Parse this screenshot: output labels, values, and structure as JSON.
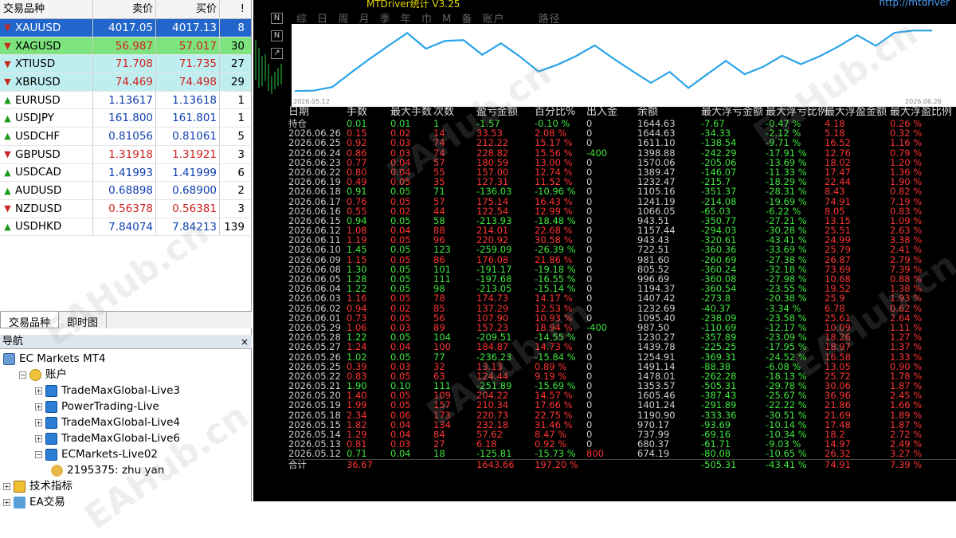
{
  "market_watch": {
    "headers": {
      "symbol": "交易品种",
      "bid": "卖价",
      "ask": "买价",
      "spread": "!"
    },
    "rows": [
      {
        "symbol": "XAUUSD",
        "bid": "4017.05",
        "ask": "4017.13",
        "spread": "8",
        "dir": "dn",
        "style": "hl-blue"
      },
      {
        "symbol": "XAGUSD",
        "bid": "56.987",
        "ask": "57.017",
        "spread": "30",
        "dir": "dn",
        "style": "hl-green"
      },
      {
        "symbol": "XTIUSD",
        "bid": "71.708",
        "ask": "71.735",
        "spread": "27",
        "dir": "dn",
        "style": "hl-cyan"
      },
      {
        "symbol": "XBRUSD",
        "bid": "74.469",
        "ask": "74.498",
        "spread": "29",
        "dir": "dn",
        "style": "hl-cyan"
      },
      {
        "symbol": "EURUSD",
        "bid": "1.13617",
        "ask": "1.13618",
        "spread": "1",
        "dir": "up",
        "style": ""
      },
      {
        "symbol": "USDJPY",
        "bid": "161.800",
        "ask": "161.801",
        "spread": "1",
        "dir": "up",
        "style": ""
      },
      {
        "symbol": "USDCHF",
        "bid": "0.81056",
        "ask": "0.81061",
        "spread": "5",
        "dir": "up",
        "style": ""
      },
      {
        "symbol": "GBPUSD",
        "bid": "1.31918",
        "ask": "1.31921",
        "spread": "3",
        "dir": "dn",
        "style": ""
      },
      {
        "symbol": "USDCAD",
        "bid": "1.41993",
        "ask": "1.41999",
        "spread": "6",
        "dir": "up",
        "style": ""
      },
      {
        "symbol": "AUDUSD",
        "bid": "0.68898",
        "ask": "0.68900",
        "spread": "2",
        "dir": "up",
        "style": ""
      },
      {
        "symbol": "NZDUSD",
        "bid": "0.56378",
        "ask": "0.56381",
        "spread": "3",
        "dir": "dn",
        "style": ""
      },
      {
        "symbol": "USDHKD",
        "bid": "7.84074",
        "ask": "7.84213",
        "spread": "139",
        "dir": "up",
        "style": ""
      }
    ],
    "tabs": [
      "交易品种",
      "即时图"
    ]
  },
  "navigator": {
    "title": "导航",
    "close": "×",
    "items": [
      {
        "label": "EC Markets MT4",
        "level": 0,
        "pm": "",
        "icon": "ic-server"
      },
      {
        "label": "账户",
        "level": 1,
        "pm": "-",
        "icon": "ic-folder"
      },
      {
        "label": "TradeMaxGlobal-Live3",
        "level": 2,
        "pm": "+",
        "icon": "ic-acct"
      },
      {
        "label": "PowerTrading-Live",
        "level": 2,
        "pm": "+",
        "icon": "ic-acct"
      },
      {
        "label": "TradeMaxGlobal-Live4",
        "level": 2,
        "pm": "+",
        "icon": "ic-acct"
      },
      {
        "label": "TradeMaxGlobal-Live6",
        "level": 2,
        "pm": "+",
        "icon": "ic-acct"
      },
      {
        "label": "ECMarkets-Live02",
        "level": 2,
        "pm": "-",
        "icon": "ic-acct"
      },
      {
        "label": "2195375: zhu yan",
        "level": 3,
        "pm": "",
        "icon": "ic-user"
      },
      {
        "label": "技术指标",
        "level": 0,
        "pm": "+",
        "icon": "ic-ind"
      },
      {
        "label": "EA交易",
        "level": 0,
        "pm": "+",
        "icon": "ic-ea"
      }
    ]
  },
  "panel": {
    "title": "MTDriver统计  V3.25",
    "url": "http://mtdriver",
    "menu": [
      "综",
      "日",
      "周",
      "月",
      "季",
      "年",
      "巾",
      "M",
      "备",
      "账户"
    ],
    "path_label": "路径",
    "chart_data": {
      "type": "line",
      "x_start": "2026.05.12",
      "x_end": "2026.06.26",
      "color": "#29a3e8",
      "values": [
        674.19,
        680.37,
        737.99,
        970.17,
        1190.9,
        1401.24,
        1605.46,
        1353.57,
        1478.01,
        1491.14,
        1254.91,
        1439.78,
        1230.27,
        987.5,
        1095.4,
        1232.69,
        1407.42,
        1194.37,
        996.69,
        805.52,
        981.6,
        722.51,
        943.43,
        1157.44,
        943.51,
        1066.05,
        1241.19,
        1105.16,
        1232.47,
        1389.47,
        1570.06,
        1398.88,
        1611.1,
        1644.63,
        1644.63
      ]
    },
    "table": {
      "headers": [
        "日期",
        "手数",
        "最大手数",
        "次数",
        "盈亏金额",
        "百分比%",
        "出入金",
        "余额",
        "最大浮亏金额",
        "最大浮亏比例",
        "最大浮盈金额",
        "最大浮盈比例"
      ],
      "rows": [
        [
          "持仓",
          "0.01",
          "0.01",
          "1",
          "-1.57",
          "-0.10 %",
          "0",
          "1644.63",
          "-7.67",
          "-0.47 %",
          "4.18",
          "0.26 %"
        ],
        [
          "2026.06.26",
          "0.15",
          "0.02",
          "14",
          "33.53",
          "2.08 %",
          "0",
          "1644.63",
          "-34.33",
          "-2.12 %",
          "5.18",
          "0.32 %"
        ],
        [
          "2026.06.25",
          "0.92",
          "0.03",
          "74",
          "212.22",
          "15.17 %",
          "0",
          "1611.10",
          "-138.54",
          "-9.71 %",
          "16.52",
          "1.16 %"
        ],
        [
          "2026.06.24",
          "0.86",
          "0.03",
          "74",
          "228.82",
          "15.56 %",
          "-400",
          "1398.88",
          "-242.29",
          "-17.91 %",
          "12.76",
          "0.79 %"
        ],
        [
          "2026.06.23",
          "0.77",
          "0.04",
          "57",
          "180.59",
          "13.00 %",
          "0",
          "1570.06",
          "-205.06",
          "-13.69 %",
          "18.02",
          "1.20 %"
        ],
        [
          "2026.06.22",
          "0.80",
          "0.04",
          "55",
          "157.00",
          "12.74 %",
          "0",
          "1389.47",
          "-146.07",
          "-11.33 %",
          "17.47",
          "1.36 %"
        ],
        [
          "2026.06.19",
          "0.49",
          "0.05",
          "35",
          "127.31",
          "11.52 %",
          "0",
          "1232.47",
          "-215.7",
          "-18.29 %",
          "22.44",
          "1.90 %"
        ],
        [
          "2026.06.18",
          "0.91",
          "0.05",
          "71",
          "-136.03",
          "-10.96 %",
          "0",
          "1105.16",
          "-351.37",
          "-28.31 %",
          "8.43",
          "0.82 %"
        ],
        [
          "2026.06.17",
          "0.76",
          "0.05",
          "57",
          "175.14",
          "16.43 %",
          "0",
          "1241.19",
          "-214.08",
          "-19.69 %",
          "74.91",
          "7.19 %"
        ],
        [
          "2026.06.16",
          "0.55",
          "0.02",
          "44",
          "122.54",
          "12.99 %",
          "0",
          "1066.05",
          "-65.03",
          "-6.22 %",
          "8.05",
          "0.83 %"
        ],
        [
          "2026.06.15",
          "0.94",
          "0.05",
          "58",
          "-213.93",
          "-18.48 %",
          "0",
          "943.51",
          "-350.77",
          "-27.21 %",
          "13.15",
          "1.09 %"
        ],
        [
          "2026.06.12",
          "1.08",
          "0.04",
          "88",
          "214.01",
          "22.68 %",
          "0",
          "1157.44",
          "-294.03",
          "-30.28 %",
          "25.51",
          "2.63 %"
        ],
        [
          "2026.06.11",
          "1.19",
          "0.05",
          "96",
          "220.92",
          "30.58 %",
          "0",
          "943.43",
          "-320.61",
          "-43.41 %",
          "24.99",
          "3.38 %"
        ],
        [
          "2026.06.10",
          "1.45",
          "0.05",
          "123",
          "-259.09",
          "-26.39 %",
          "0",
          "722.51",
          "-360.36",
          "-33.69 %",
          "25.79",
          "2.41 %"
        ],
        [
          "2026.06.09",
          "1.15",
          "0.05",
          "86",
          "176.08",
          "21.86 %",
          "0",
          "981.60",
          "-260.69",
          "-27.38 %",
          "26.87",
          "2.79 %"
        ],
        [
          "2026.06.08",
          "1.30",
          "0.05",
          "101",
          "-191.17",
          "-19.18 %",
          "0",
          "805.52",
          "-360.24",
          "-32.18 %",
          "73.69",
          "7.39 %"
        ],
        [
          "2026.06.05",
          "1.28",
          "0.05",
          "111",
          "-197.68",
          "-16.55 %",
          "0",
          "996.69",
          "-360.08",
          "-27.98 %",
          "10.68",
          "0.88 %"
        ],
        [
          "2026.06.04",
          "1.22",
          "0.05",
          "98",
          "-213.05",
          "-15.14 %",
          "0",
          "1194.37",
          "-360.54",
          "-23.55 %",
          "19.52",
          "1.38 %"
        ],
        [
          "2026.06.03",
          "1.16",
          "0.05",
          "78",
          "174.73",
          "14.17 %",
          "0",
          "1407.42",
          "-273.8",
          "-20.38 %",
          "25.9",
          "1.93 %"
        ],
        [
          "2026.06.02",
          "0.94",
          "0.02",
          "85",
          "137.29",
          "12.53 %",
          "0",
          "1232.69",
          "-40.37",
          "-3.34 %",
          "6.78",
          "0.62 %"
        ],
        [
          "2026.06.01",
          "0.73",
          "0.05",
          "56",
          "107.90",
          "10.93 %",
          "0",
          "1095.40",
          "-238.09",
          "-23.58 %",
          "25.61",
          "2.64 %"
        ],
        [
          "2026.05.29",
          "1.06",
          "0.03",
          "89",
          "157.23",
          "18.94 %",
          "-400",
          "987.50",
          "-110.69",
          "-12.17 %",
          "10.09",
          "1.11 %"
        ],
        [
          "2026.05.28",
          "1.22",
          "0.05",
          "104",
          "-209.51",
          "-14.55 %",
          "0",
          "1230.27",
          "-357.89",
          "-23.09 %",
          "18.26",
          "1.27 %"
        ],
        [
          "2026.05.27",
          "1.24",
          "0.04",
          "100",
          "184.87",
          "14.73 %",
          "0",
          "1439.78",
          "-225.25",
          "-17.95 %",
          "18.97",
          "1.37 %"
        ],
        [
          "2026.05.26",
          "1.02",
          "0.05",
          "77",
          "-236.23",
          "-15.84 %",
          "0",
          "1254.91",
          "-369.31",
          "-24.52 %",
          "16.58",
          "1.33 %"
        ],
        [
          "2026.05.25",
          "0.39",
          "0.03",
          "32",
          "13.13",
          "0.89 %",
          "0",
          "1491.14",
          "-88.38",
          "-6.08 %",
          "13.05",
          "0.90 %"
        ],
        [
          "2026.05.22",
          "0.83",
          "0.05",
          "63",
          "124.44",
          "9.19 %",
          "0",
          "1478.01",
          "-262.28",
          "-18.13 %",
          "25.72",
          "1.78 %"
        ],
        [
          "2026.05.21",
          "1.90",
          "0.10",
          "111",
          "-251.89",
          "-15.69 %",
          "0",
          "1353.57",
          "-505.31",
          "-29.78 %",
          "30.06",
          "1.87 %"
        ],
        [
          "2026.05.20",
          "1.40",
          "0.05",
          "109",
          "204.22",
          "14.57 %",
          "0",
          "1605.46",
          "-387.43",
          "-25.67 %",
          "36.96",
          "2.45 %"
        ],
        [
          "2026.05.19",
          "1.99",
          "0.05",
          "157",
          "210.34",
          "17.66 %",
          "0",
          "1401.24",
          "-291.89",
          "-22.22 %",
          "21.86",
          "1.66 %"
        ],
        [
          "2026.05.18",
          "2.34",
          "0.06",
          "173",
          "220.73",
          "22.75 %",
          "0",
          "1190.90",
          "-333.36",
          "-30.51 %",
          "21.69",
          "1.89 %"
        ],
        [
          "2026.05.15",
          "1.82",
          "0.04",
          "134",
          "232.18",
          "31.46 %",
          "0",
          "970.17",
          "-93.69",
          "-10.14 %",
          "17.48",
          "1.87 %"
        ],
        [
          "2026.05.14",
          "1.29",
          "0.04",
          "84",
          "57.62",
          "8.47 %",
          "0",
          "737.99",
          "-69.16",
          "-10.34 %",
          "18.2",
          "2.72 %"
        ],
        [
          "2026.05.13",
          "0.81",
          "0.03",
          "27",
          "6.18",
          "0.92 %",
          "0",
          "680.37",
          "-61.71",
          "-9.03 %",
          "14.97",
          "2.49 %"
        ],
        [
          "2026.05.12",
          "0.71",
          "0.04",
          "18",
          "-125.81",
          "-15.73 %",
          "800",
          "674.19",
          "-80.08",
          "-10.65 %",
          "26.32",
          "3.27 %"
        ],
        [
          "合计",
          "36.67",
          "",
          "",
          "1643.66",
          "197.20 %",
          "",
          "",
          "-505.31",
          "-43.41 %",
          "74.91",
          "7.39 %"
        ]
      ]
    }
  },
  "watermark": "EAHub.cn"
}
